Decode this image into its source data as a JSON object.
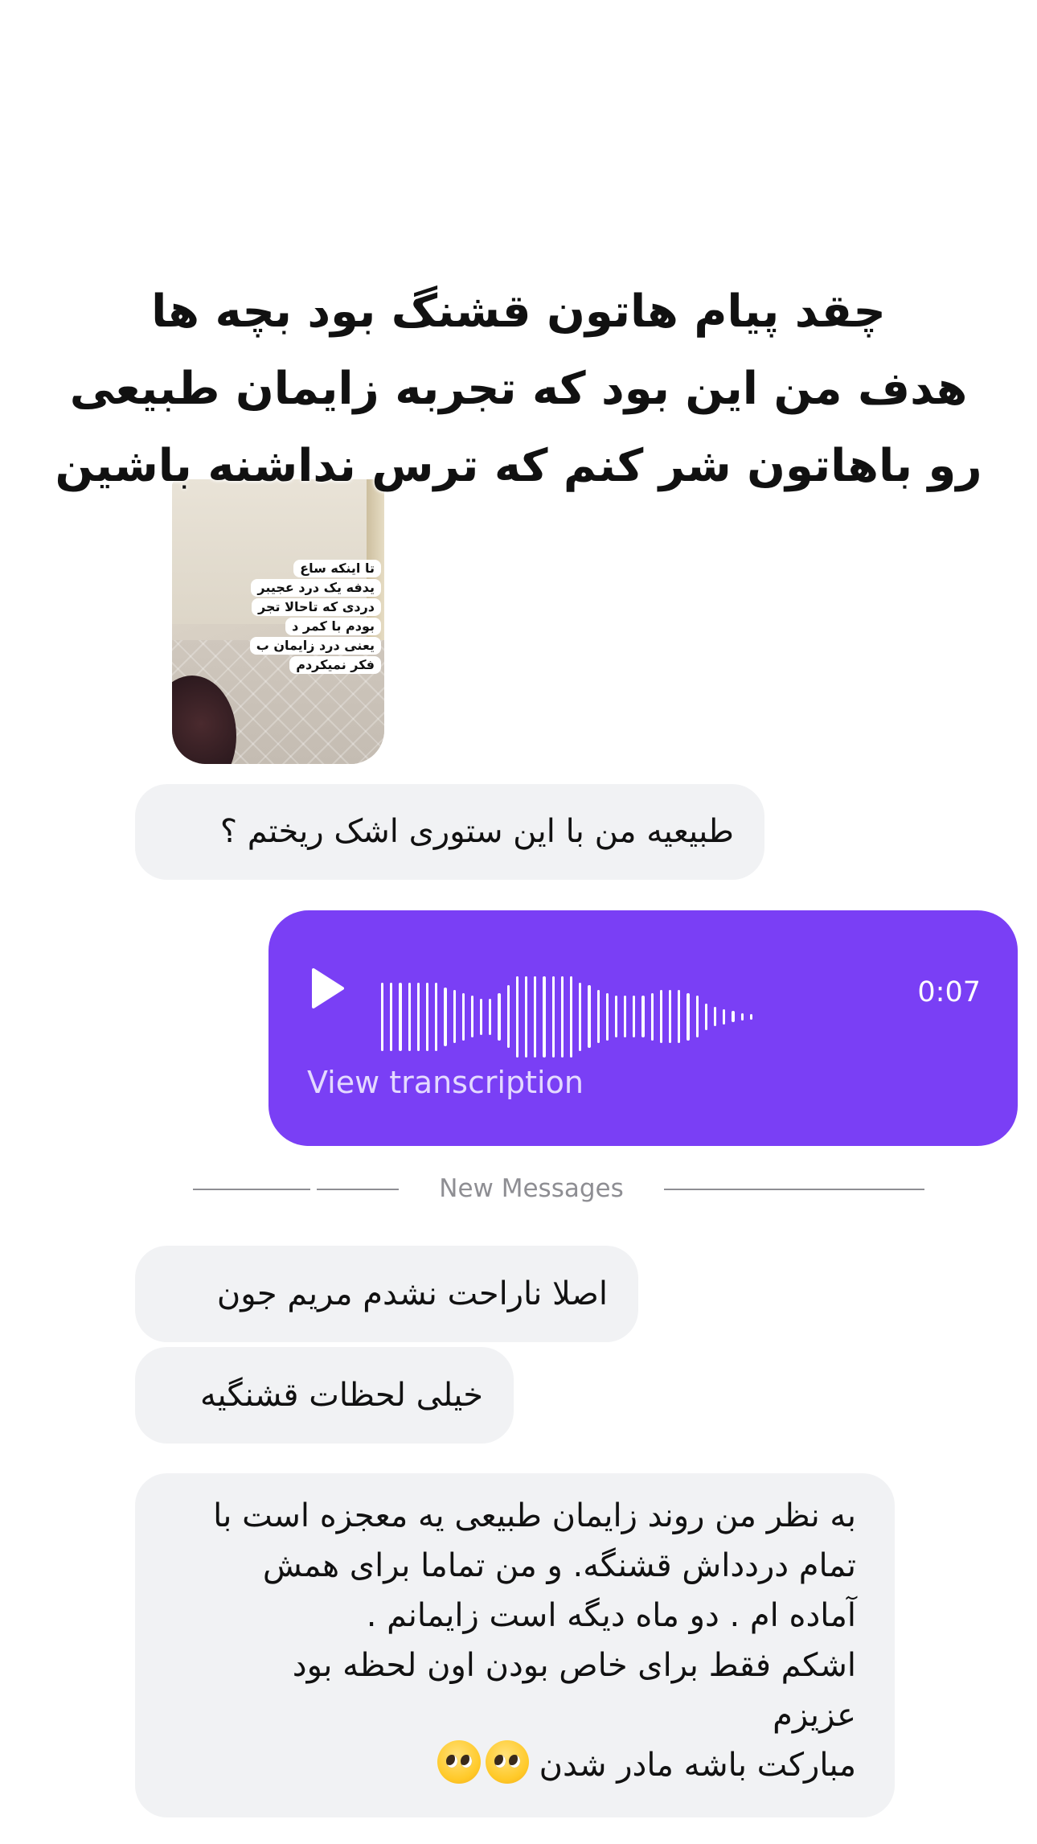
{
  "story_caption": {
    "lines": [
      "چقد پیام هاتون قشنگ بود بچه ها",
      "هدف من این بود که تجربه زایمان طبیعی",
      "رو باهاتون شر کنم که ترس نداشنه باشین"
    ]
  },
  "story_reply": {
    "overlay_lines": [
      "تا اینکه ساع",
      "یدفه یک درد عجیبر",
      "دردی که تاحالا تجر",
      "بودم با کمر د",
      "یعنی درد زایمان ب",
      "فکر نمیکردم"
    ]
  },
  "messages": {
    "received_1": "طبیعیه من با این ستوری اشک ریختم ؟",
    "voice": {
      "duration": "0:07",
      "transcription_label": "View transcription",
      "waveform_levels": [
        0.72,
        0.72,
        0.72,
        0.72,
        0.72,
        0.72,
        0.72,
        0.62,
        0.56,
        0.5,
        0.44,
        0.38,
        0.38,
        0.5,
        0.66,
        0.86,
        0.86,
        0.86,
        0.86,
        0.86,
        0.86,
        0.86,
        0.72,
        0.66,
        0.56,
        0.5,
        0.44,
        0.44,
        0.44,
        0.44,
        0.5,
        0.56,
        0.56,
        0.56,
        0.5,
        0.44,
        0.28,
        0.2,
        0.16,
        0.12,
        0.08,
        0.06
      ]
    },
    "divider_label": "New Messages",
    "received_2": "اصلا ناراحت نشدم  مریم جون",
    "received_3": "خیلی لحظات قشنگیه",
    "received_4": {
      "lines": [
        "به نظر من روند زایمان طبیعی یه معجزه است با",
        "تمام دردداش قشنگه. و من تماما برای همش",
        "آماده ام . دو ماه دیگه است زایمانم .",
        "اشکم فقط برای خاص بودن اون لحظه بود",
        "عزیزم",
        "مبارکت باشه مادر شدن"
      ],
      "emoji": [
        "pleading-face-emoji",
        "pleading-face-emoji"
      ]
    }
  },
  "colors": {
    "voice_bubble": "#7a3ff5",
    "received_bubble": "#f1f2f4",
    "divider": "#8e8e93"
  }
}
